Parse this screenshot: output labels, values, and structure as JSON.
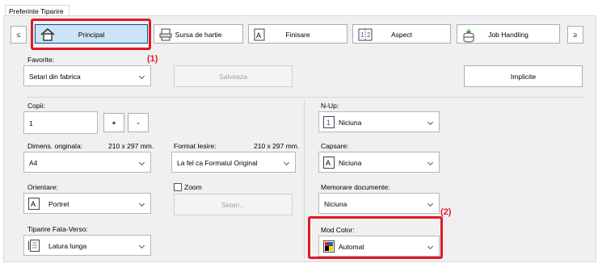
{
  "window": {
    "title": "Preferinte Tiparire"
  },
  "tabs": {
    "prev": "≤",
    "next": "≥",
    "items": [
      {
        "label": "Principal",
        "active": true,
        "icon": "home-icon"
      },
      {
        "label": "Sursa de hartie",
        "active": false,
        "icon": "paper-tray-icon"
      },
      {
        "label": "Finisare",
        "active": false,
        "icon": "finishing-icon"
      },
      {
        "label": "Aspect",
        "active": false,
        "icon": "layout-icon"
      },
      {
        "label": "Job Handling",
        "active": false,
        "icon": "job-handling-icon"
      }
    ]
  },
  "favorites": {
    "label": "Favorite:",
    "value": "Setari din fabrica",
    "save_label": "Salveaza",
    "defaults_label": "Implicite"
  },
  "copies": {
    "label": "Copii:",
    "value": "1",
    "plus": "+",
    "minus": "-"
  },
  "original_size": {
    "label": "Dimens. originala:",
    "dims": "210 x 297 mm.",
    "value": "A4"
  },
  "output_size": {
    "label": "Format Iesire:",
    "dims": "210 x 297 mm.",
    "value": "La fel ca Formatul Original"
  },
  "orientation": {
    "label": "Orientare:",
    "value": "Portret"
  },
  "zoom": {
    "label": "Zoom",
    "settings_label": "Setari..."
  },
  "duplex": {
    "label": "Tiparire Fata-Verso:",
    "value": "Latura lunga"
  },
  "n_up": {
    "label": "N-Up:",
    "value": "Niciuna"
  },
  "stapling": {
    "label": "Capsare:",
    "value": "Niciuna"
  },
  "document_filing": {
    "label": "Memorare documente:",
    "value": "Niciuna"
  },
  "color_mode": {
    "label": "Mod Color:",
    "value": "Automat"
  },
  "callouts": {
    "one": "(1)",
    "two": "(2)",
    "color": "#e0192a"
  },
  "colors": {
    "active_tab_bg": "#cce4f7",
    "active_tab_border": "#005499"
  }
}
